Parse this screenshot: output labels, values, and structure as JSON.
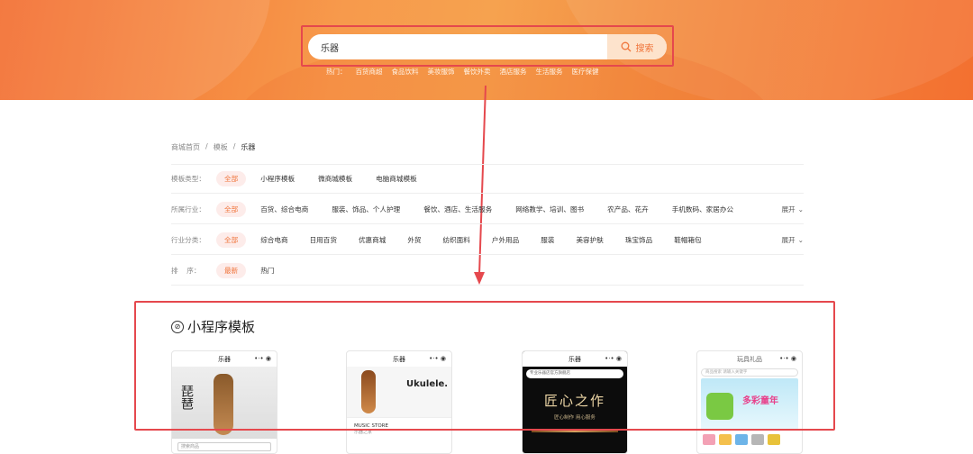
{
  "search": {
    "value": "乐器",
    "button_label": "搜索"
  },
  "hot": {
    "label": "热门：",
    "items": [
      "百货商超",
      "食品饮料",
      "美妆服饰",
      "餐饮外卖",
      "酒店服务",
      "生活服务",
      "医疗保健"
    ]
  },
  "breadcrumb": {
    "items": [
      "商城首页",
      "模板",
      "乐器"
    ],
    "sep": "/"
  },
  "filters": {
    "type": {
      "label": "模板类型：",
      "options": [
        "全部",
        "小程序模板",
        "微商城模板",
        "电脑商城模板"
      ]
    },
    "industry": {
      "label": "所属行业：",
      "options": [
        "全部",
        "百货、综合电商",
        "服装、饰品、个人护理",
        "餐饮、酒店、生活服务",
        "网络教学、培训、图书",
        "农产品、花卉",
        "手机数码、家居办公"
      ],
      "expand": "展开"
    },
    "category": {
      "label": "行业分类：",
      "options": [
        "全部",
        "综合电商",
        "日用百货",
        "优惠商城",
        "外贸",
        "纺织面料",
        "户外用品",
        "服装",
        "美容护肤",
        "珠宝饰品",
        "鞋帽箱包"
      ],
      "expand": "展开"
    },
    "sort": {
      "label": "排    序：",
      "options": [
        "最新",
        "热门"
      ]
    }
  },
  "section": {
    "title": "小程序模板"
  },
  "cards": [
    {
      "title": "乐器",
      "banner": "琵琶",
      "search_hint": "搜索商品"
    },
    {
      "title": "乐器",
      "banner": "Ukulele.",
      "sub": "MUSIC STORE",
      "sub2": "乐器之家"
    },
    {
      "title": "乐器",
      "search_hint": "专业乐器店官方旗舰店",
      "banner": "匠心之作",
      "sub": "匠心制作 用心服务"
    },
    {
      "title": "玩具礼品",
      "search_hint": "商品搜索 请输入关键字",
      "banner": "多彩童年"
    }
  ]
}
